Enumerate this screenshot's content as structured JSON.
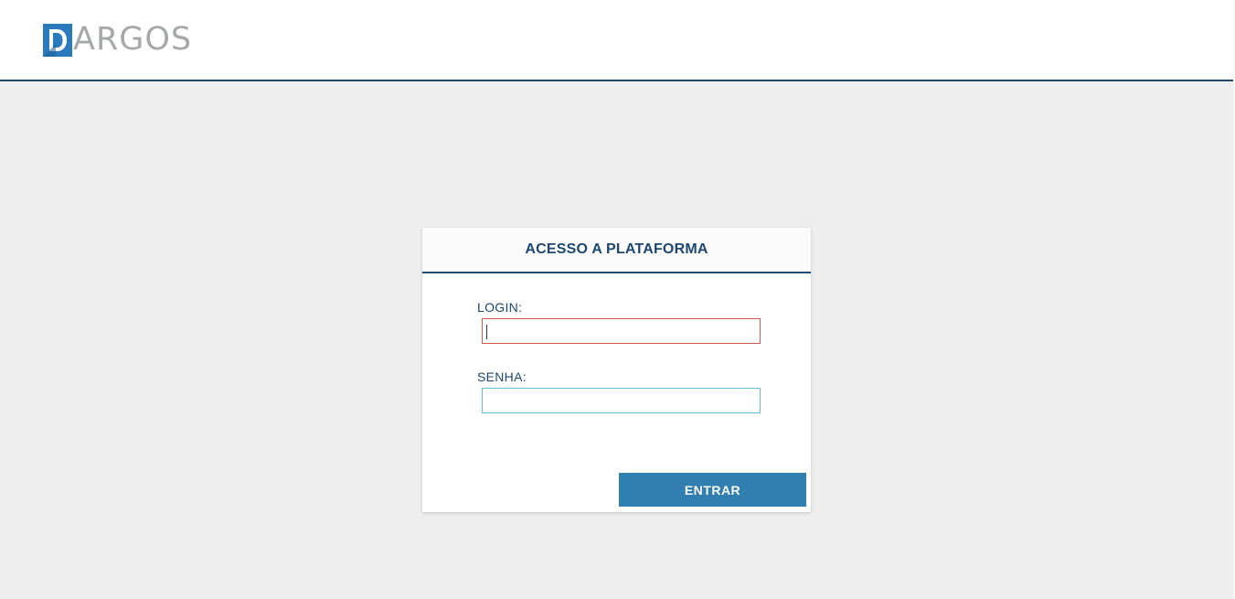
{
  "brand": {
    "logo_letter": "D",
    "logo_text": "ARGOS",
    "colors": {
      "logo_blue": "#2a7bbd",
      "logo_gray": "#a6a8aa",
      "header_line": "#1f4a70"
    }
  },
  "login_card": {
    "title": "ACESSO A PLATAFORMA",
    "login_label": "LOGIN:",
    "login_value": "",
    "password_label": "SENHA:",
    "password_value": "",
    "submit_label": "ENTRAR",
    "colors": {
      "title": "#1d4770",
      "button": "#317eb0",
      "error_border": "#d15a4e",
      "input_border": "#5fc0d4"
    }
  }
}
